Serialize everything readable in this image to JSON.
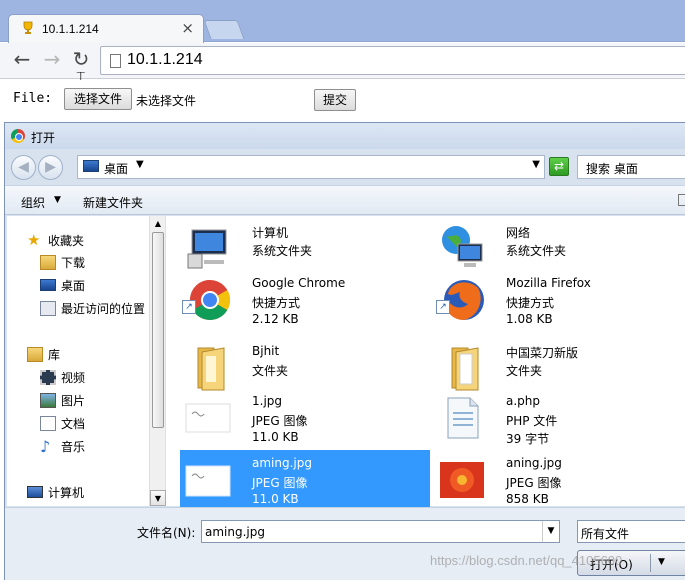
{
  "browser": {
    "tab_title": "10.1.1.214",
    "tab_close": "×",
    "url": "10.1.1.214",
    "back_glyph": "←",
    "forward_glyph": "→",
    "reload_glyph": "↻",
    "cursor_glyph": "⌶"
  },
  "page": {
    "file_label": "File:",
    "choose_file_button": "选择文件",
    "no_file_text": "未选择文件",
    "submit_button": "提交"
  },
  "dialog": {
    "title": "打开",
    "location": "桌面",
    "search_placeholder": "搜索 桌面",
    "organize": "组织",
    "new_folder": "新建文件夹",
    "nav": {
      "favorites": "收藏夹",
      "downloads": "下载",
      "desktop": "桌面",
      "recent": "最近访问的位置",
      "libraries": "库",
      "videos": "视频",
      "pictures": "图片",
      "documents": "文档",
      "music": "音乐",
      "computer": "计算机"
    },
    "files": [
      {
        "name": "计算机",
        "type": "系统文件夹",
        "size": ""
      },
      {
        "name": "网络",
        "type": "系统文件夹",
        "size": ""
      },
      {
        "name": "Google Chrome",
        "type": "快捷方式",
        "size": "2.12 KB"
      },
      {
        "name": "Mozilla Firefox",
        "type": "快捷方式",
        "size": "1.08 KB"
      },
      {
        "name": "Bjhit",
        "type": "文件夹",
        "size": ""
      },
      {
        "name": "中国菜刀新版",
        "type": "文件夹",
        "size": ""
      },
      {
        "name": "1.jpg",
        "type": "JPEG 图像",
        "size": "11.0 KB"
      },
      {
        "name": "a.php",
        "type": "PHP 文件",
        "size": "39 字节"
      },
      {
        "name": "aming.jpg",
        "type": "JPEG 图像",
        "size": "11.0 KB"
      },
      {
        "name": "aning.jpg",
        "type": "JPEG 图像",
        "size": "858 KB"
      }
    ],
    "filename_label": "文件名(N):",
    "filename_value": "aming.jpg",
    "filetype_value": "所有文件",
    "open_button": "打开(O)"
  },
  "watermark": "https://blog.csdn.net/qq_4105600",
  "colors": {
    "selection": "#3399ff",
    "tabstrip": "#9db5e0"
  }
}
